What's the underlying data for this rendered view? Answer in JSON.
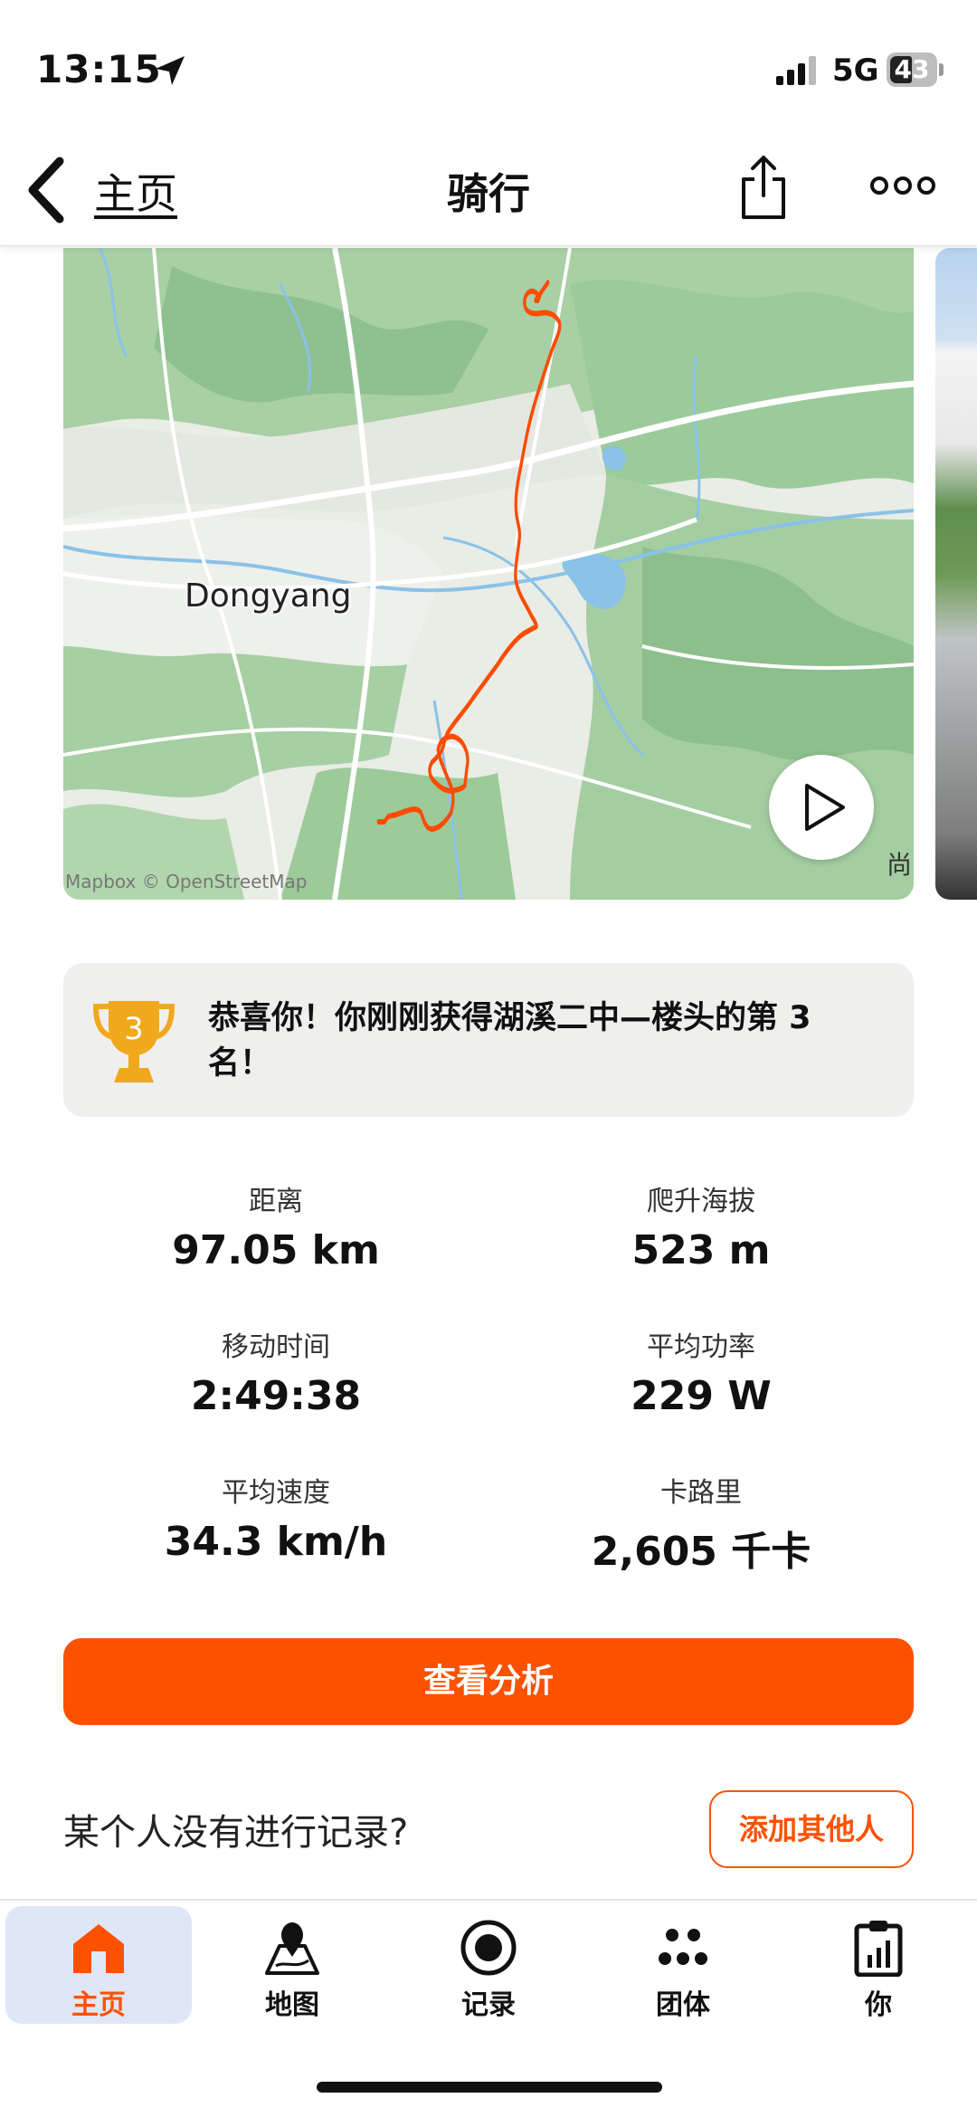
{
  "status_bar": {
    "time": "13:15",
    "network": "5G",
    "battery": "43"
  },
  "header": {
    "back_label": "主页",
    "title": "骑行"
  },
  "map": {
    "city_label": "Dongyang",
    "attribution": "Mapbox © OpenStreetMap",
    "corner_text": "尚"
  },
  "achievement": {
    "text": "恭喜你！你刚刚获得湖溪二中—楼头的第 3 名！",
    "rank": "3"
  },
  "stats": [
    {
      "label": "距离",
      "value": "97.05 km"
    },
    {
      "label": "爬升海拔",
      "value": "523 m"
    },
    {
      "label": "移动时间",
      "value": "2:49:38"
    },
    {
      "label": "平均功率",
      "value": "229 W"
    },
    {
      "label": "平均速度",
      "value": "34.3 km/h"
    },
    {
      "label": "卡路里",
      "value": "2,605 千卡"
    }
  ],
  "analysis_button": "查看分析",
  "record_question": "某个人没有进行记录?",
  "add_button": "添加其他人",
  "tabs": [
    {
      "label": "主页",
      "icon": "home-icon",
      "active": true
    },
    {
      "label": "地图",
      "icon": "map-icon",
      "active": false
    },
    {
      "label": "记录",
      "icon": "record-icon",
      "active": false
    },
    {
      "label": "团体",
      "icon": "groups-icon",
      "active": false
    },
    {
      "label": "你",
      "icon": "profile-icon",
      "active": false
    }
  ],
  "colors": {
    "accent": "#fc5200",
    "route": "#fc4c02",
    "trophy": "#f0a81c"
  }
}
